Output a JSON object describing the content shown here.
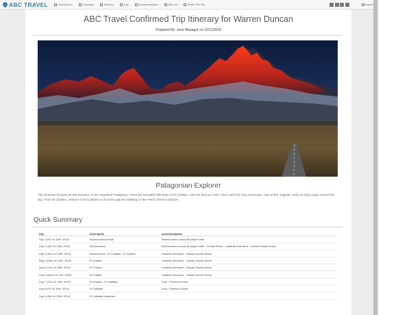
{
  "brand": {
    "name": "ABC TRAVEL",
    "color": "#3a7ea8"
  },
  "nav": {
    "items": [
      {
        "label": "Introduction",
        "icon": "info-icon"
      },
      {
        "label": "Summary",
        "icon": "list-icon"
      },
      {
        "label": "Itinerary",
        "icon": "calendar-icon"
      },
      {
        "label": "Day",
        "icon": "day-icon"
      },
      {
        "label": "Accommodation",
        "icon": "home-icon"
      },
      {
        "label": "Why Us",
        "icon": "chat-icon"
      },
      {
        "label": "Book This Trip",
        "icon": "book-icon"
      }
    ],
    "social": [
      "facebook-icon",
      "twitter-icon",
      "pinterest-icon",
      "email-icon"
    ],
    "export_label": "Export"
  },
  "header": {
    "title": "ABC Travel Confirmed Trip Itinerary for Warren Duncan",
    "prepared_by": "Prepared By: Jane Manager on 12/11/2018"
  },
  "tour": {
    "name": "Patagonian Explorer",
    "description": "This itinerary focuses on the wonders of the Argentine Patagonia. From the beautiful little town of El Chalten, visit the famous Cerro Torre and Fitz Roy mountains. Awe at the majestic rocks as they surge toward the sky. From El Chalten, venture to El Calafate to do some glacier trekking on the Perito Moreno Glacier."
  },
  "summary": {
    "title": "Quick Summary",
    "columns": [
      "Day",
      "Description",
      "Accommodation"
    ],
    "rows": [
      {
        "day": "Day 1 (Fri Jul 12th, 2019)",
        "desc": "Buenos Aires Arrival",
        "acc": "Buenos Aires Luxury Boutique Hotel"
      },
      {
        "day": "Day 2 (Sat Jul 13th, 2019)",
        "desc": "Buenos Aires",
        "acc": "Buenos Aires Luxury Boutique Hotel - Double Room , Hosts Buenos Aires - Deluxe Double Room"
      },
      {
        "day": "Day 3 (Sun Jul 14th, 2019)",
        "desc": "Buenos Aires - El Calafate - El Chalten",
        "acc": "Hosteria Senderos - Classic Double Room"
      },
      {
        "day": "Day 4 (Mon Jul 15th, 2019)",
        "desc": "El Chalten",
        "acc": "Hosteria Senderos - Classic Double Room"
      },
      {
        "day": "Day 5 (Tue Jul 16th, 2019)",
        "desc": "El Chalten",
        "acc": "Hosteria Senderos - Classic Double Room"
      },
      {
        "day": "Day 6 (Wed Jul 17th, 2019)",
        "desc": "El Chalten",
        "acc": "Hosteria Senderos - Classic Double Room"
      },
      {
        "day": "Day 7 (Thu Jul 18th, 2019)",
        "desc": "El Chalten - El Calafate",
        "acc": "Eolo - Premium Room"
      },
      {
        "day": "Day 8 (Fri Jul 19th, 2019)",
        "desc": "El Calafate",
        "acc": "Eolo - Premium Room"
      },
      {
        "day": "Day 9 (Sat Jul 20th, 2019)",
        "desc": "El Calafate Departure",
        "acc": ""
      }
    ]
  }
}
